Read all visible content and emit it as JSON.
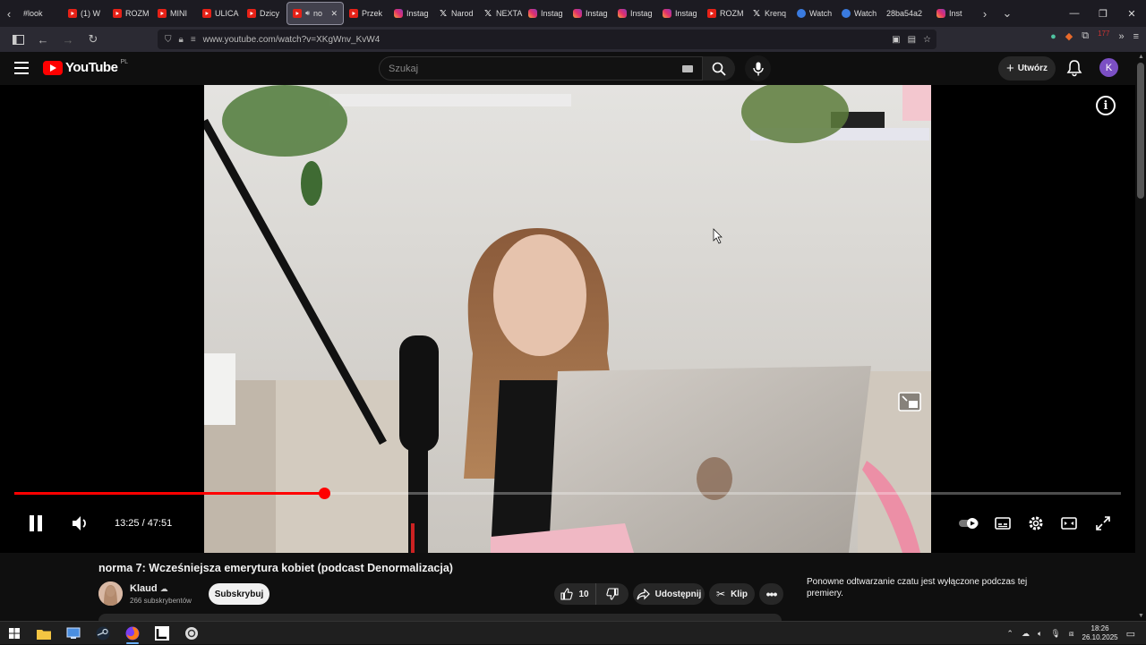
{
  "browser": {
    "tabs": [
      {
        "label": "#look",
        "icon": "none"
      },
      {
        "label": "(1) W",
        "icon": "youtube"
      },
      {
        "label": "ROZM",
        "icon": "youtube"
      },
      {
        "label": "MINI",
        "icon": "youtube"
      },
      {
        "label": "ULICA",
        "icon": "youtube"
      },
      {
        "label": "Dzicy",
        "icon": "youtube"
      },
      {
        "label": "no",
        "icon": "youtube",
        "active": true
      },
      {
        "label": "Przek",
        "icon": "youtube"
      },
      {
        "label": "Instag",
        "icon": "instagram"
      },
      {
        "label": "Narod",
        "icon": "x"
      },
      {
        "label": "NEXTA",
        "icon": "x"
      },
      {
        "label": "Instag",
        "icon": "instagram"
      },
      {
        "label": "Instag",
        "icon": "instagram"
      },
      {
        "label": "Instag",
        "icon": "instagram"
      },
      {
        "label": "Instag",
        "icon": "instagram"
      },
      {
        "label": "ROZM",
        "icon": "youtube"
      },
      {
        "label": "Krenq",
        "icon": "x"
      },
      {
        "label": "Watch",
        "icon": "blue"
      },
      {
        "label": "Watch",
        "icon": "blue"
      },
      {
        "label": "28ba54a2",
        "icon": "none"
      },
      {
        "label": "Inst",
        "icon": "instagram"
      }
    ],
    "url": "www.youtube.com/watch?v=XKgWnv_KvW4",
    "extensions_badge": "177"
  },
  "youtube": {
    "logo_text": "YouTube",
    "country_code": "PL",
    "search_placeholder": "Szukaj",
    "create_label": "Utwórz",
    "avatar_letter": "K"
  },
  "player": {
    "current_time": "13:25",
    "duration": "47:51",
    "time_display": "13:25 / 47:51",
    "progress_fraction": 0.28,
    "state": "playing"
  },
  "video": {
    "title": "norma 7: Wcześniejsza emerytura kobiet (podcast Denormalizacja)",
    "channel_name": "Klaud",
    "subscribers": "266 subskrybentów",
    "subscribe_label": "Subskrybuj",
    "likes": "10",
    "share_label": "Udostępnij",
    "clip_label": "Klip",
    "chat_note": "Ponowne odtwarzanie czatu jest wyłączone podczas tej premiery."
  },
  "taskbar": {
    "time": "18:26",
    "date": "26.10.2025"
  },
  "colors": {
    "accent": "#ff0000",
    "background": "#0f0f0f",
    "pill": "#272727"
  }
}
